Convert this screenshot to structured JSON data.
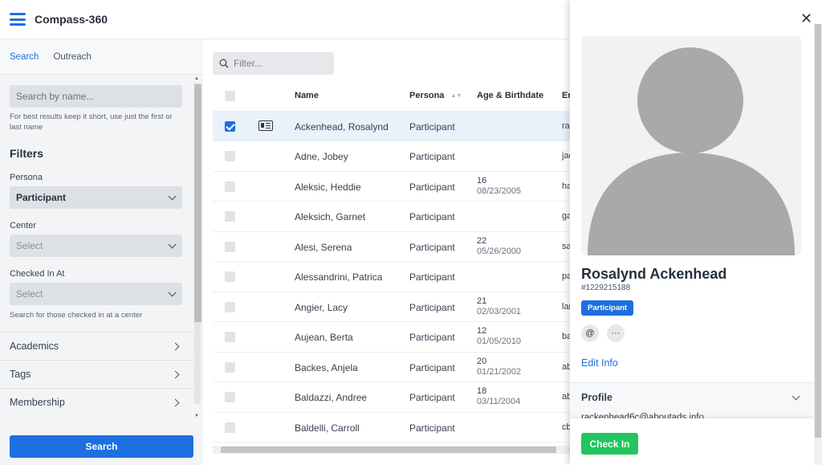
{
  "header": {
    "app_title": "Compass-360"
  },
  "left": {
    "tabs": [
      "Search",
      "Outreach"
    ],
    "name_search": {
      "placeholder": "Search by name...",
      "hint": "For best results keep it short, use just the first or last name"
    },
    "filters_title": "Filters",
    "persona": {
      "label": "Persona",
      "value": "Participant"
    },
    "center": {
      "label": "Center",
      "value": "Select"
    },
    "checked_in": {
      "label": "Checked In At",
      "value": "Select",
      "hint": "Search for those checked in at a center"
    },
    "sections": [
      "Academics",
      "Tags",
      "Membership"
    ],
    "search_button": "Search"
  },
  "table": {
    "filter_placeholder": "Filter...",
    "columns": {
      "name": "Name",
      "persona": "Persona",
      "age": "Age & Birthdate",
      "email": "Em"
    },
    "rows": [
      {
        "name": "Ackenhead, Rosalynd",
        "persona": "Participant",
        "age": "",
        "dob": "",
        "email": "rac",
        "selected": true
      },
      {
        "name": "Adne, Jobey",
        "persona": "Participant",
        "age": "",
        "dob": "",
        "email": "jac"
      },
      {
        "name": "Aleksic, Heddie",
        "persona": "Participant",
        "age": "16",
        "dob": "08/23/2005",
        "email": "ha"
      },
      {
        "name": "Aleksich, Garnet",
        "persona": "Participant",
        "age": "",
        "dob": "",
        "email": "ga"
      },
      {
        "name": "Alesi, Serena",
        "persona": "Participant",
        "age": "22",
        "dob": "05/26/2000",
        "email": "sal"
      },
      {
        "name": "Alessandrini, Patrica",
        "persona": "Participant",
        "age": "",
        "dob": "",
        "email": "pa"
      },
      {
        "name": "Angier, Lacy",
        "persona": "Participant",
        "age": "21",
        "dob": "02/03/2001",
        "email": "lar"
      },
      {
        "name": "Aujean, Berta",
        "persona": "Participant",
        "age": "12",
        "dob": "01/05/2010",
        "email": "ba"
      },
      {
        "name": "Backes, Anjela",
        "persona": "Participant",
        "age": "20",
        "dob": "01/21/2002",
        "email": "ab"
      },
      {
        "name": "Baldazzi, Andree",
        "persona": "Participant",
        "age": "18",
        "dob": "03/11/2004",
        "email": "ab"
      },
      {
        "name": "Baldelli, Carroll",
        "persona": "Participant",
        "age": "",
        "dob": "",
        "email": "cb"
      }
    ]
  },
  "detail": {
    "name": "Rosalynd Ackenhead",
    "id": "#1229215188",
    "persona_badge": "Participant",
    "email_button": "@",
    "more_button": "···",
    "edit_link": "Edit Info",
    "profile_title": "Profile",
    "profile_email": "rackenhead6c@aboutads.info",
    "checkin_button": "Check In"
  },
  "colors": {
    "accent": "#1e6fe0",
    "success": "#22c55e"
  }
}
